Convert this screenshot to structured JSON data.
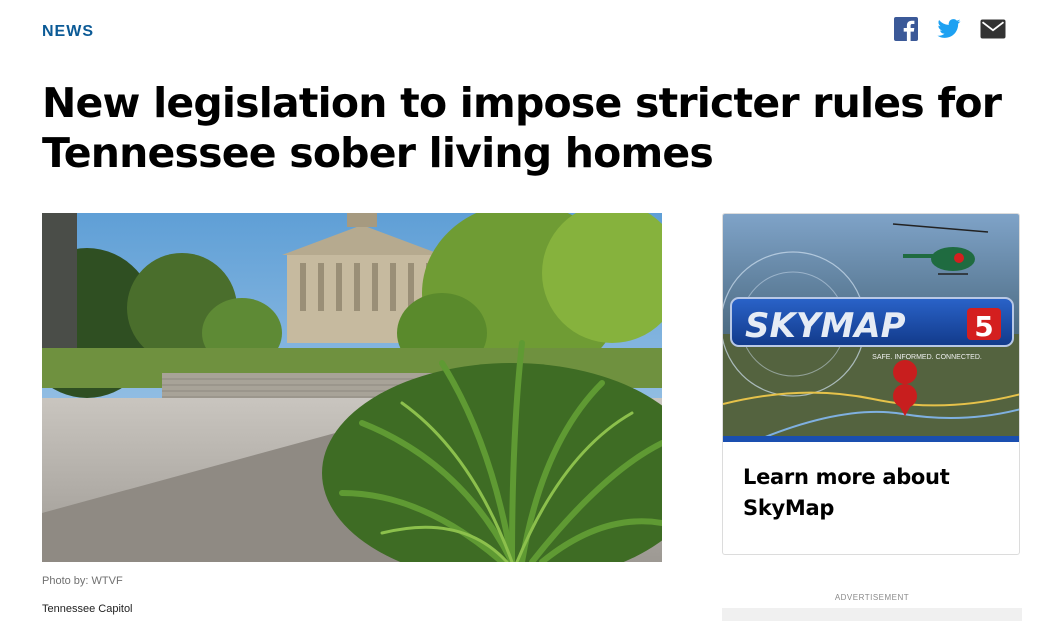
{
  "section": {
    "label": "NEWS"
  },
  "share": {
    "icons": [
      "facebook-icon",
      "twitter-icon",
      "email-icon"
    ],
    "colors": {
      "facebook": "#3b5998",
      "twitter": "#1da1f2",
      "email": "#333333"
    }
  },
  "article": {
    "headline": "New legislation to impose stricter rules for Tennessee sober living homes",
    "photo_credit": "Photo by: WTVF",
    "photo_caption": "Tennessee Capitol"
  },
  "sidebar": {
    "promo": {
      "logo_text": "SKYMAP",
      "logo_number": "5",
      "tagline": "SAFE. INFORMED. CONNECTED.",
      "title": "Learn more about SkyMap"
    },
    "ad_label": "ADVERTISEMENT"
  },
  "colors": {
    "accent": "#0b5a96",
    "promo_blue": "#1a4fb0",
    "promo_red": "#d41f1f"
  }
}
